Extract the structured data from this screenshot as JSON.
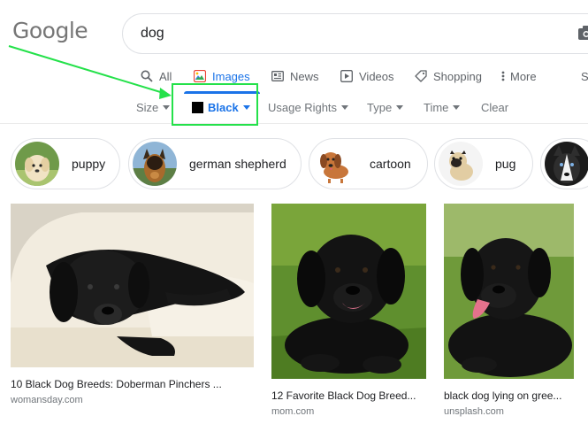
{
  "logo": "Google",
  "search": {
    "query": "dog"
  },
  "tabs": [
    {
      "label": "All",
      "icon": "search-icon"
    },
    {
      "label": "Images",
      "icon": "image-icon",
      "active": true
    },
    {
      "label": "News",
      "icon": "newspaper-icon"
    },
    {
      "label": "Videos",
      "icon": "play-icon"
    },
    {
      "label": "Shopping",
      "icon": "tag-icon"
    },
    {
      "label": "More",
      "icon": "more-vertical-icon"
    }
  ],
  "tools": {
    "size": "Size",
    "color": "Black",
    "usage_rights": "Usage Rights",
    "type": "Type",
    "time": "Time",
    "clear": "Clear"
  },
  "chips": [
    {
      "label": "puppy"
    },
    {
      "label": "german shepherd"
    },
    {
      "label": "cartoon"
    },
    {
      "label": "pug"
    }
  ],
  "results": [
    {
      "title": "10 Black Dog Breeds: Doberman Pinchers ...",
      "source": "womansday.com"
    },
    {
      "title": "12 Favorite Black Dog Breed...",
      "source": "mom.com"
    },
    {
      "title": "black dog lying on gree...",
      "source": "unsplash.com"
    }
  ],
  "colors": {
    "accent": "#1a73e8",
    "annotation": "#24e14a",
    "swatch": "#000000"
  }
}
